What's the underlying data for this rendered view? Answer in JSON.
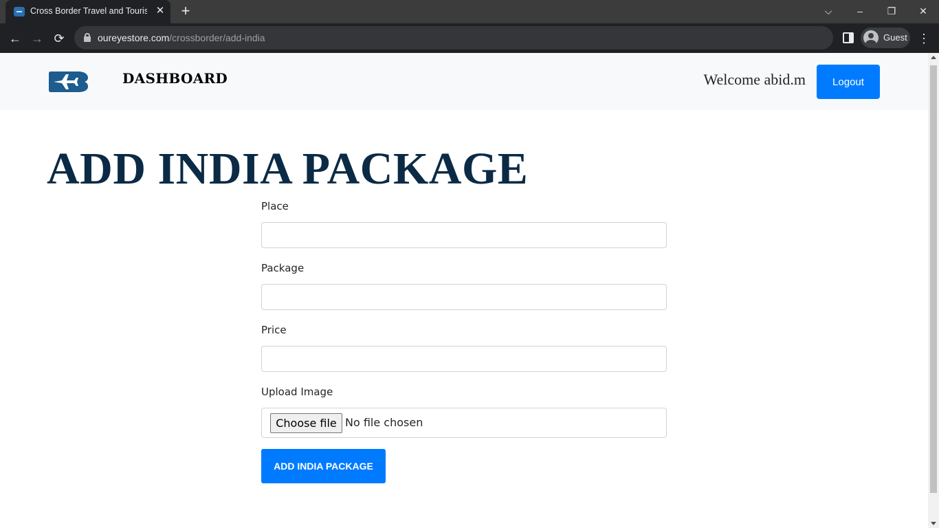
{
  "browser": {
    "tab_title": "Cross Border Travel and Tourism",
    "tab_close_icon": "close-icon",
    "new_tab_symbol": "+",
    "url_host": "oureyestore.com",
    "url_path": "/crossborder/add-india",
    "profile_label": "Guest",
    "window_controls": {
      "dropdown": "⌵",
      "minimize": "–",
      "restore": "❐",
      "close": "✕"
    },
    "nav": {
      "back": "←",
      "forward": "→",
      "reload": "⟳",
      "menu": "⋮"
    }
  },
  "header": {
    "brand": "DASHBOARD",
    "welcome": "Welcome abid.m",
    "logout_label": "Logout",
    "logo_icon": "airplane-logo-icon"
  },
  "page": {
    "title": "ADD INDIA PACKAGE"
  },
  "form": {
    "place_label": "Place",
    "place_value": "",
    "package_label": "Package",
    "package_value": "",
    "price_label": "Price",
    "price_value": "",
    "upload_label": "Upload Image",
    "choose_file_label": "Choose file",
    "file_status": "No file chosen",
    "submit_label": "ADD INDIA PACKAGE"
  },
  "colors": {
    "accent": "#007bff",
    "title": "#0b2a45",
    "logo": "#1c5c8e",
    "header_bg": "#f8f9fa"
  }
}
